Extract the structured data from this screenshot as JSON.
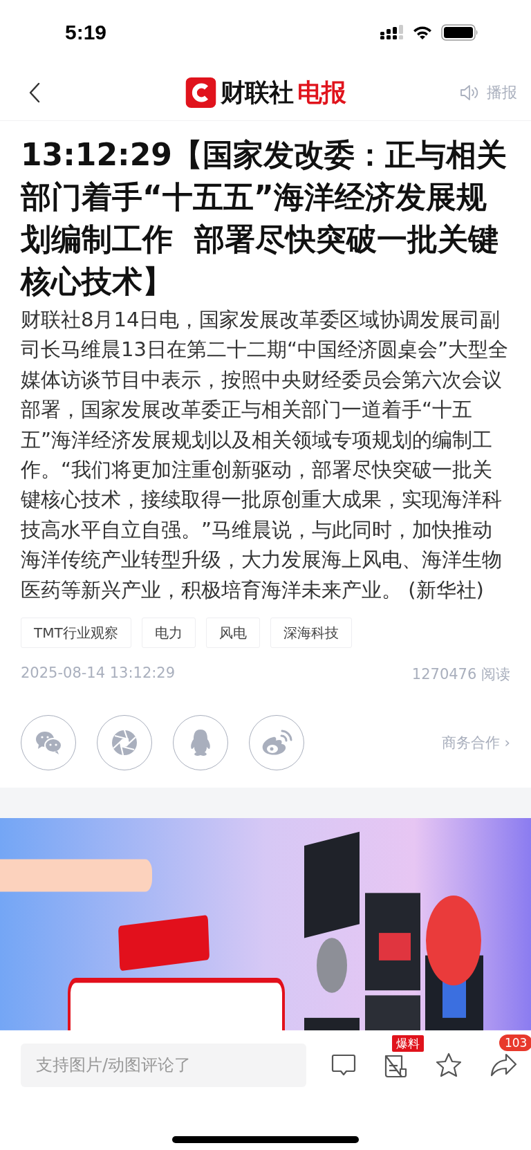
{
  "status_bar": {
    "time": "5:19"
  },
  "nav": {
    "brand": "财联社",
    "brand_accent": "电报",
    "broadcast": "播报"
  },
  "article": {
    "title": "13:12:29【国家发改委：正与相关部门着手“十五五”海洋经济发展规划编制工作  部署尽快突破一批关键核心技术】",
    "body": "财联社8月14日电，国家发展改革委区域协调发展司副司长马维晨13日在第二十二期“中国经济圆桌会”大型全媒体访谈节目中表示，按照中央财经委员会第六次会议部署，国家发展改革委正与相关部门一道着手“十五五”海洋经济发展规划以及相关领域专项规划的编制工作。“我们将更加注重创新驱动，部署尽快突破一批关键核心技术，接续取得一批原创重大成果，实现海洋科技高水平自立自强。”马维晨说，与此同时，加快推动海洋传统产业转型升级，大力发展海上风电、海洋生物医药等新兴产业，积极培育海洋未来产业。 (新华社)",
    "tags": [
      "TMT行业观察",
      "电力",
      "风电",
      "深海科技"
    ],
    "datetime": "2025-08-14 13:12:29",
    "reads": "1270476 阅读"
  },
  "share": {
    "targets": [
      {
        "kind": "wechat"
      },
      {
        "kind": "moments"
      },
      {
        "kind": "qq"
      },
      {
        "kind": "weibo"
      }
    ],
    "business": "商务合作 ›"
  },
  "bottom_bar": {
    "placeholder": "支持图片/动图评论了",
    "actions": [
      {
        "kind": "comment"
      },
      {
        "kind": "report",
        "badge": "爆料"
      },
      {
        "kind": "favorite"
      },
      {
        "kind": "share",
        "badge": "103"
      }
    ]
  }
}
